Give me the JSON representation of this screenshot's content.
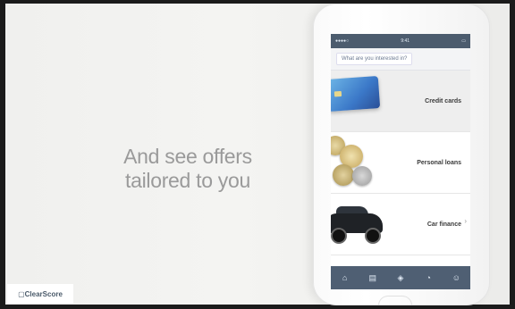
{
  "tagline": {
    "line1": "And see offers",
    "line2": "tailored to you"
  },
  "brand": {
    "prefix": "▢ ",
    "name": "ClearScore"
  },
  "phone": {
    "status": {
      "left": "●●●●○",
      "center": "9:41",
      "right": "▭"
    },
    "question": "What are you interested in?",
    "offers": [
      {
        "label": "Credit cards",
        "icon": "credit-card-illustration"
      },
      {
        "label": "Personal loans",
        "icon": "coins-illustration"
      },
      {
        "label": "Car finance",
        "icon": "car-illustration"
      }
    ],
    "tabs": [
      "home-icon",
      "report-icon",
      "offers-icon",
      "coach-icon",
      "profile-icon"
    ]
  },
  "colors": {
    "status_bar": "#4c5c6e",
    "tab_bar": "#4f5f73",
    "tagline": "#9a9a9a",
    "card": "#3b78c8"
  }
}
